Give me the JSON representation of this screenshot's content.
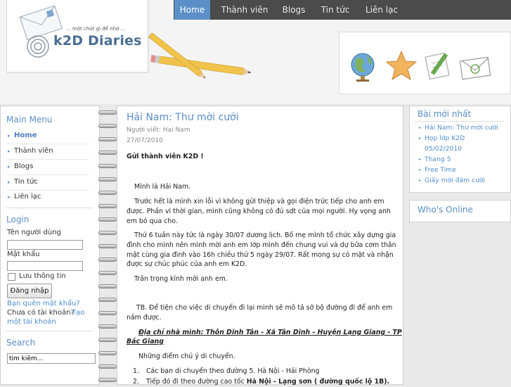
{
  "site": {
    "tagline": "... một chút gì để nhớ ...",
    "logo": "k2D Diaries"
  },
  "topnav": [
    "Home",
    "Thành viên",
    "Blogs",
    "Tin tức",
    "Liên lạc"
  ],
  "sidebar": {
    "menu_title": "Main Menu",
    "menu": [
      "Home",
      "Thành viên",
      "Blogs",
      "Tin tức",
      "Liên lạc"
    ],
    "login_title": "Login",
    "username_label": "Tên người dùng",
    "password_label": "Mật khẩu",
    "remember_label": "Lưu thông tin",
    "login_button": "Đăng nhập",
    "forgot_link": "Bạn quên mật khẩu?",
    "no_account_text": "Chưa có tài khoản?",
    "register_link_1": "Tạo",
    "register_link_2": "một tài khoản",
    "search_title": "Search",
    "search_value": "tìm kiếm..."
  },
  "article": {
    "title": "Hải Nam: Thư mời cưới",
    "author": "Người viết: Hai Nam",
    "date": "27/07/2010",
    "greeting": "Gửi thành viên K2D !",
    "p1": "Mình là Hải Nam.",
    "p2_l1": "Trước hết là mình xin lỗi vì không gửi thiệp và gọi điện trức tiếp cho anh em",
    "p2_l2": "được. Phần vì thời gian, mình cũng không có đủ sdt của mọi người. Hy vọng anh",
    "p2_l3": "em bỏ qua cho.",
    "p3_l1": "Thứ 6 tuần này tức là ngày 30/07 dương lịch. Bố mẹ mình tổ chức xây dựng gia",
    "p3_l2": "đình cho mình nên mình mời anh em lớp mình đến chung vui và dự bữa cơm thân",
    "p3_l3": "mật cùng gia đình vào 16h chiều thứ 5 ngày 29/07. Rất mong sự có mặt và  nhận",
    "p3_l4": "được sự chúc phúc của anh em K2D.",
    "p4": "Trân trọng kính mời anh em.",
    "p5_l1": "TB. Để tiện cho việc di chuyển đi lại mình sẽ mô tả sở bộ đường đi để anh em",
    "p5_l2": "nắm được.",
    "address_l1": "Địa chỉ nhà mình: Thôn Dĩnh Tân - Xã Tân Dĩnh - Huyện Lạng Giang - TP",
    "address_l2": "Bắc Giang",
    "notes_intro": "Những điểm chú ý di chuyển.",
    "list_1_num": "1.",
    "list_1": "Các bạn di chuyển theo đường 5. Hà Nội - Hải Phòng",
    "list_2_num": "2.",
    "list_2_pre": "Tiếp đó đi theo đường cao tốc ",
    "list_2_bold": "Hà Nội - Lạng sơn ( đường quốc lộ 1B)."
  },
  "rightbar": {
    "latest_title": "Bài mới nhất",
    "latest": [
      "Hải Nam: Thư mời cưới",
      "Họp lớp K2D",
      "05/02/2010",
      "Thang 5",
      "Free Time",
      "Giấy mời đám cưới"
    ],
    "online_title": "Who's Online"
  },
  "colors": {
    "accent": "#5a8ec8",
    "nav_bg": "#4b4b4b",
    "nav_active": "#5c8fc7"
  },
  "icons": [
    "envelope-icon",
    "pencil-icon",
    "globe-icon",
    "star-icon",
    "pen-icon",
    "mail-icon",
    "arrow-bullet-icon"
  ]
}
